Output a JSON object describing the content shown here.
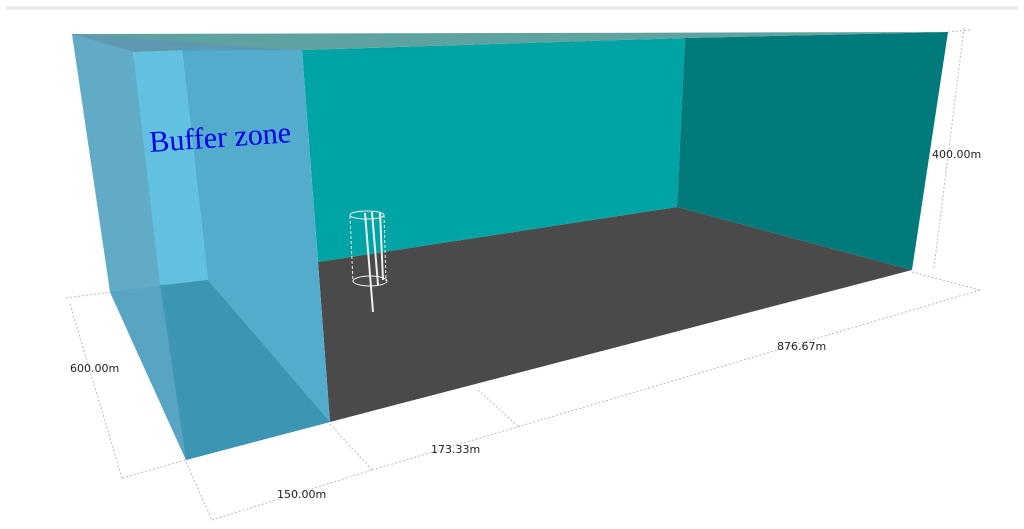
{
  "scene": {
    "buffer_label": "Buffer zone",
    "dimensions": {
      "depth": "600.00m",
      "buffer_width": "150.00m",
      "inner_offset": "173.33m",
      "length": "876.67m",
      "height": "400.00m"
    },
    "colors": {
      "buffer": "#4aa8c8",
      "back_wall": "#00a4a4",
      "side_wall": "#007a7a",
      "floor": "#4a4a4a",
      "top": "#5fa3a0",
      "label": "#0000ee"
    }
  }
}
